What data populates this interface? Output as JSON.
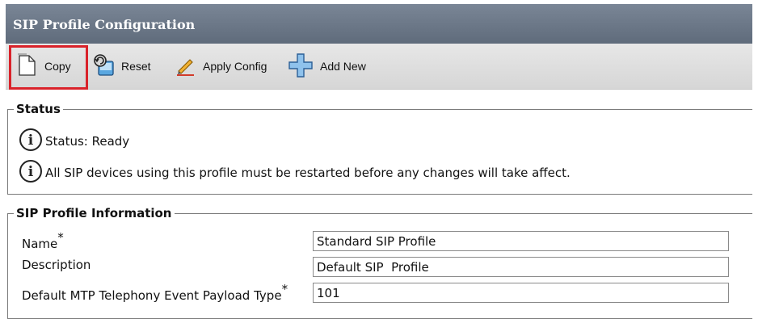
{
  "window": {
    "title": "SIP Profile Configuration"
  },
  "toolbar": {
    "buttons": [
      {
        "label": "Copy",
        "icon": "copy-icon",
        "highlighted": true
      },
      {
        "label": "Reset",
        "icon": "reset-icon"
      },
      {
        "label": "Apply Config",
        "icon": "apply-config-icon"
      },
      {
        "label": "Add New",
        "icon": "add-new-icon"
      }
    ],
    "highlight_color": "#d9222a"
  },
  "status": {
    "legend": "Status",
    "messages": [
      {
        "icon": "info-icon",
        "text": "Status: Ready"
      },
      {
        "icon": "info-icon",
        "text": "All SIP devices using this profile must be restarted before any changes will take affect."
      }
    ]
  },
  "profile_info": {
    "legend": "SIP Profile Information",
    "fields": [
      {
        "label": "Name",
        "required": "*",
        "value": "Standard SIP Profile"
      },
      {
        "label": "Description",
        "required": "",
        "value": "Default SIP  Profile"
      },
      {
        "label": "Default MTP Telephony Event Payload Type",
        "required": "*",
        "value": "101"
      }
    ]
  },
  "colors": {
    "titlebar": "#6b7787",
    "toolbar": "#dedede"
  }
}
